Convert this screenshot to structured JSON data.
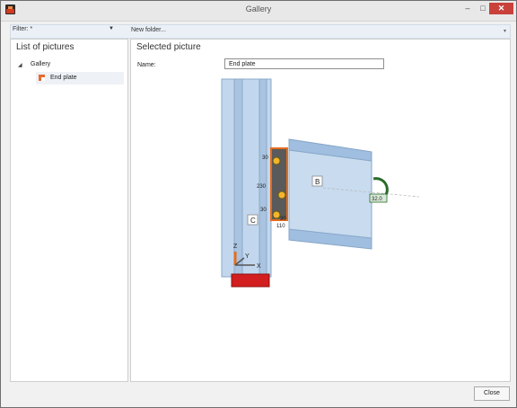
{
  "window": {
    "title": "Gallery"
  },
  "window_controls": {
    "min": "–",
    "max": "□",
    "close": "✕"
  },
  "toolbar": {
    "filter": "Filter: *",
    "new_folder": "New folder..."
  },
  "left_panel": {
    "title": "List of pictures",
    "tree": {
      "root": "Gallery",
      "items": [
        "End plate"
      ]
    }
  },
  "right_panel": {
    "title": "Selected picture",
    "name_label": "Name:",
    "name_value": "End plate"
  },
  "picture": {
    "labels": [
      "B",
      "C"
    ],
    "dimensions": [
      "30",
      "230",
      "30",
      "30",
      "110"
    ],
    "rotation": "32.0",
    "axes": [
      "Z",
      "Y",
      "X"
    ]
  },
  "buttons": {
    "close": "Close"
  },
  "colors": {
    "accent_red": "#c9413a",
    "steel_blue": "#b8d0ea",
    "plate_orange": "#f18b2a",
    "base_red": "#d21e1e"
  }
}
